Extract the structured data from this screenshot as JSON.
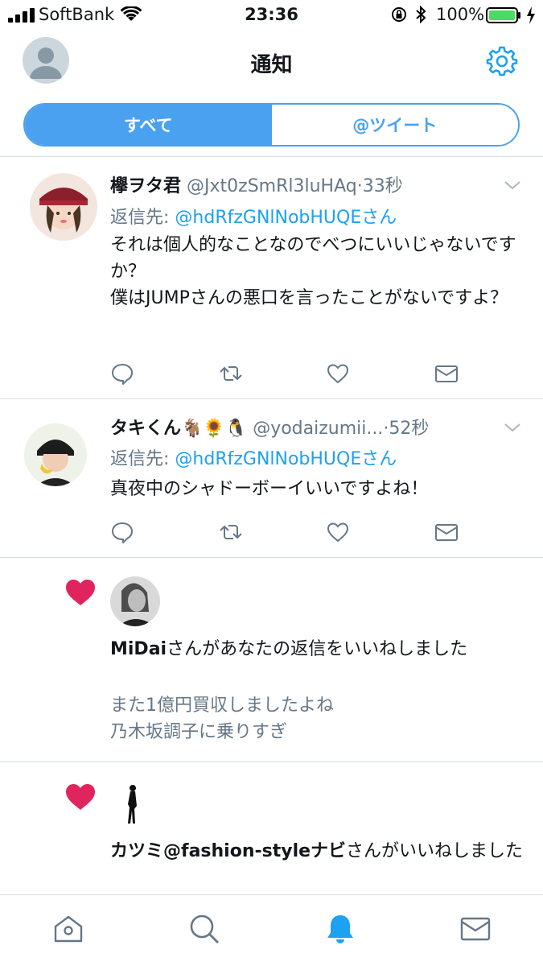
{
  "status_bar": {
    "carrier": "SoftBank",
    "time": "23:36",
    "battery": "100%"
  },
  "header": {
    "title": "通知"
  },
  "segments": {
    "all": "すべて",
    "mentions": "@ツイート"
  },
  "tweets": [
    {
      "name": "欅ヲタ君",
      "handle": "@Jxt0zSmRl3luHAq",
      "time": "33秒",
      "reply_prefix": "返信先: ",
      "reply_to": "@hdRfzGNlNobHUQEさん",
      "body": "それは個人的なことなのでべつにいいじゃないですか？\n僕はJUMPさんの悪口を言ったことがないですよ？"
    },
    {
      "name": "タキくん🐐🌻🐧",
      "handle": "@yodaizumii...",
      "time": "52秒",
      "reply_prefix": "返信先: ",
      "reply_to": "@hdRfzGNlNobHUQEさん",
      "body": "真夜中のシャドーボーイいいですよね！"
    }
  ],
  "likes": [
    {
      "user": "MiDai",
      "action": "さんがあなたの返信をいいねしました",
      "snippet": "また1億円買収しましたよね\n乃木坂調子に乗りすぎ"
    },
    {
      "user": "カツミ@fashion-styleナビ",
      "action": "さんがいいねしました",
      "snippet": ""
    }
  ],
  "colors": {
    "accent": "#4aa1f0",
    "link": "#1da1f2",
    "heart": "#e0245e",
    "muted": "#657786"
  },
  "icons": {
    "header": [
      "avatar",
      "gear-icon"
    ],
    "actions": [
      "reply-icon",
      "retweet-icon",
      "like-icon",
      "dm-icon"
    ],
    "tabs": [
      "home-icon",
      "search-icon",
      "notifications-icon",
      "messages-icon"
    ]
  }
}
